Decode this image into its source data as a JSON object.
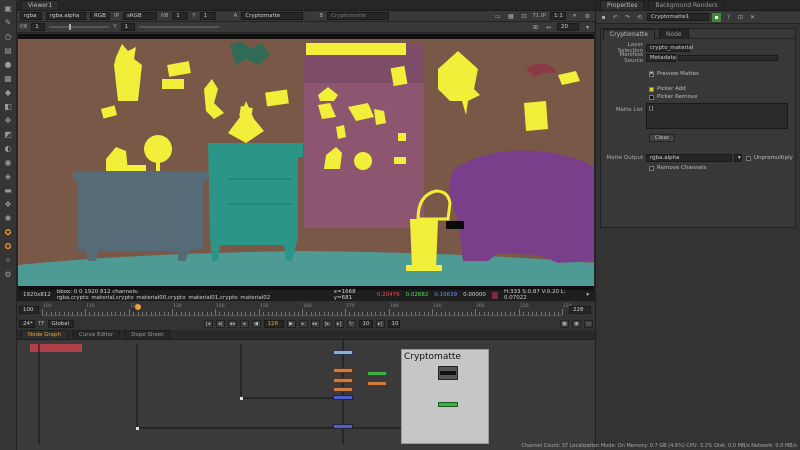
{
  "viewer": {
    "tab": "Viewer1",
    "toolbar1": {
      "layer": "rgba",
      "channel": "rgba.alpha",
      "colorspace": "RGB",
      "display_lut_label": "sRGB",
      "gain_label": "f/8",
      "gain_value": "1",
      "gamma_label": "Y",
      "gamma_value": "1",
      "input_a_label": "A",
      "input_a": "Cryptomatte",
      "input_b_label": "B",
      "input_b": "Cryptomatte",
      "fps": "71.IP",
      "zoom": "1:1"
    },
    "toolbar2": {
      "exposure_label": "f/8",
      "exposure_value": "1",
      "gamma_label": "Y",
      "gamma_value": "1",
      "frame": "20"
    },
    "info": {
      "format": "1920x812",
      "bbox": "bbox: 0 0 1920 812 channels: rgba,crypto_material,crypto_material00,crypto_material01,crypto_material02",
      "coords": "x=1668 y=681",
      "r": "0.20479",
      "g": "0.02682",
      "b": "0.10639",
      "a": "0.00000",
      "hsvl": "H:333 S:0.87 V:0.20 L: 0.07022"
    },
    "timeline": {
      "fps": "24*",
      "tf_label": "TF",
      "range_mode": "Global",
      "current_frame": "128",
      "step_frames": "10",
      "step2": "10",
      "start": "100",
      "end": "228",
      "ruler_labels": [
        "100",
        "110",
        "120",
        "130",
        "140",
        "150",
        "160",
        "170",
        "180",
        "190",
        "200",
        "210",
        "220"
      ],
      "left_start": "100",
      "right_end": "228"
    }
  },
  "nodegraph": {
    "tabs": [
      "Node Graph",
      "Curve Editor",
      "Dope Sheet"
    ],
    "backdrop_label": "Cryptomatte"
  },
  "properties": {
    "tabs": [
      "Properties",
      "Background Renders"
    ],
    "node_name": "Cryptomatte1",
    "subtabs": [
      "Cryptomatte",
      "Node"
    ],
    "layer_selection_label": "Layer Selection",
    "layer_selection_value": "crypto_material",
    "manifest_source_label": "Manifest Source",
    "manifest_source_value": "Metadata",
    "preview_mattes_label": "Preview Mattes",
    "picker_add_label": "Picker Add",
    "picker_remove_label": "Picker Remove",
    "matte_list_label": "Matte List",
    "matte_list_value": "[]",
    "clear_label": "Clear",
    "matte_output_label": "Matte Output",
    "matte_output_value": "rgba.alpha",
    "unpremultiply_label": "Unpremultiply",
    "remove_channels_label": "Remove Channels"
  },
  "status": "Channel Count: 37  Localization Mode: On  Memory: 0.7 GB (4.6%)  CPU: 3.2%  Disk: 0.0 MB/s  Network: 0.0 MB/s",
  "colors": {
    "matte_yellow": "#f2ef3a",
    "wall": "#7a5848",
    "cabinet": "#2b9588",
    "sideboard": "#556c78",
    "shelf": "#8c5570",
    "sofa": "#7a3f8a",
    "floor": "#4e9a94",
    "accent_orange": "#f0a030"
  }
}
